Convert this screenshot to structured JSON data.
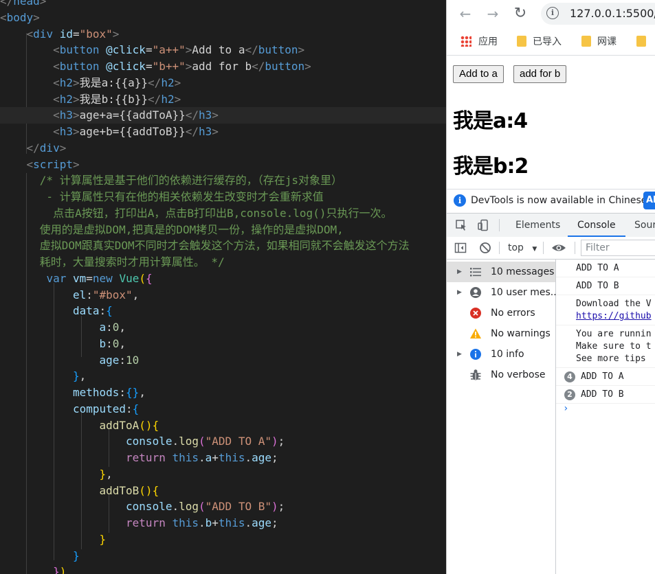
{
  "editor": {
    "lines": [
      [
        {
          "t": "</",
          "c": "t-tag"
        },
        {
          "t": "head",
          "c": "t-el"
        },
        {
          "t": ">",
          "c": "t-tag"
        }
      ],
      [
        {
          "t": "<",
          "c": "t-tag"
        },
        {
          "t": "body",
          "c": "t-el"
        },
        {
          "t": ">",
          "c": "t-tag"
        }
      ],
      [
        {
          "t": "    "
        },
        {
          "t": "<",
          "c": "t-tag"
        },
        {
          "t": "div",
          "c": "t-el"
        },
        {
          "t": " "
        },
        {
          "t": "id",
          "c": "t-attr"
        },
        {
          "t": "=",
          "c": "t-txt"
        },
        {
          "t": "\"box\"",
          "c": "t-str"
        },
        {
          "t": ">",
          "c": "t-tag"
        }
      ],
      [
        {
          "t": "        "
        },
        {
          "t": "<",
          "c": "t-tag"
        },
        {
          "t": "button",
          "c": "t-el"
        },
        {
          "t": " "
        },
        {
          "t": "@click",
          "c": "t-attr"
        },
        {
          "t": "=",
          "c": "t-txt"
        },
        {
          "t": "\"a++\"",
          "c": "t-str"
        },
        {
          "t": ">",
          "c": "t-tag"
        },
        {
          "t": "Add to a",
          "c": "t-txt"
        },
        {
          "t": "</",
          "c": "t-tag"
        },
        {
          "t": "button",
          "c": "t-el"
        },
        {
          "t": ">",
          "c": "t-tag"
        }
      ],
      [
        {
          "t": "        "
        },
        {
          "t": "<",
          "c": "t-tag"
        },
        {
          "t": "button",
          "c": "t-el"
        },
        {
          "t": " "
        },
        {
          "t": "@click",
          "c": "t-attr"
        },
        {
          "t": "=",
          "c": "t-txt"
        },
        {
          "t": "\"b++\"",
          "c": "t-str"
        },
        {
          "t": ">",
          "c": "t-tag"
        },
        {
          "t": "add for b",
          "c": "t-txt"
        },
        {
          "t": "</",
          "c": "t-tag"
        },
        {
          "t": "button",
          "c": "t-el"
        },
        {
          "t": ">",
          "c": "t-tag"
        }
      ],
      [
        {
          "t": "        "
        },
        {
          "t": "<",
          "c": "t-tag"
        },
        {
          "t": "h2",
          "c": "t-el"
        },
        {
          "t": ">",
          "c": "t-tag"
        },
        {
          "t": "我是a:{{a}}",
          "c": "t-txt"
        },
        {
          "t": "</",
          "c": "t-tag"
        },
        {
          "t": "h2",
          "c": "t-el"
        },
        {
          "t": ">",
          "c": "t-tag"
        }
      ],
      [
        {
          "t": "        "
        },
        {
          "t": "<",
          "c": "t-tag"
        },
        {
          "t": "h2",
          "c": "t-el"
        },
        {
          "t": ">",
          "c": "t-tag"
        },
        {
          "t": "我是b:{{b}}",
          "c": "t-txt"
        },
        {
          "t": "</",
          "c": "t-tag"
        },
        {
          "t": "h2",
          "c": "t-el"
        },
        {
          "t": ">",
          "c": "t-tag"
        }
      ],
      [
        {
          "t": "        "
        },
        {
          "t": "<",
          "c": "t-tag"
        },
        {
          "t": "h3",
          "c": "t-el"
        },
        {
          "t": ">",
          "c": "t-tag"
        },
        {
          "t": "age+a={{addToA}}",
          "c": "t-txt"
        },
        {
          "t": "</",
          "c": "t-tag"
        },
        {
          "t": "h3",
          "c": "t-el"
        },
        {
          "t": ">",
          "c": "t-tag"
        }
      ],
      [
        {
          "t": "        "
        },
        {
          "t": "<",
          "c": "t-tag"
        },
        {
          "t": "h3",
          "c": "t-el"
        },
        {
          "t": ">",
          "c": "t-tag"
        },
        {
          "t": "age+b={{addToB}}",
          "c": "t-txt"
        },
        {
          "t": "</",
          "c": "t-tag"
        },
        {
          "t": "h3",
          "c": "t-el"
        },
        {
          "t": ">",
          "c": "t-tag"
        }
      ],
      [
        {
          "t": "    "
        },
        {
          "t": "</",
          "c": "t-tag"
        },
        {
          "t": "div",
          "c": "t-el"
        },
        {
          "t": ">",
          "c": "t-tag"
        }
      ],
      [
        {
          "t": "    "
        },
        {
          "t": "<",
          "c": "t-tag"
        },
        {
          "t": "script",
          "c": "t-el"
        },
        {
          "t": ">",
          "c": "t-tag"
        }
      ],
      [
        {
          "t": "      "
        },
        {
          "t": "/* 计算属性是基于他们的依赖进行缓存的，（存在js对象里）",
          "c": "t-com"
        }
      ],
      [
        {
          "t": "      "
        },
        {
          "t": " - 计算属性只有在他的相关依赖发生改变时才会重新求值",
          "c": "t-com"
        }
      ],
      [
        {
          "t": "      "
        },
        {
          "t": "  点击A按钮，打印出A，点击B打印出B,console.log()只执行一次。",
          "c": "t-com"
        }
      ],
      [
        {
          "t": "      "
        },
        {
          "t": "使用的是虚拟DOM,把真是的DOM拷贝一份，操作的是虚拟DOM,",
          "c": "t-com"
        }
      ],
      [
        {
          "t": "      "
        },
        {
          "t": "虚拟DOM跟真实DOM不同时才会触发这个方法，如果相同就不会触发这个方法",
          "c": "t-com"
        }
      ],
      [
        {
          "t": "      "
        },
        {
          "t": "耗时，大量搜索时才用计算属性。 */",
          "c": "t-com"
        }
      ],
      [
        {
          "t": "       "
        },
        {
          "t": "var",
          "c": "t-kw"
        },
        {
          "t": " "
        },
        {
          "t": "vm",
          "c": "t-var"
        },
        {
          "t": "="
        },
        {
          "t": "new",
          "c": "t-kw"
        },
        {
          "t": " "
        },
        {
          "t": "Vue",
          "c": "t-cls"
        },
        {
          "t": "(",
          "c": "t-br1"
        },
        {
          "t": "{",
          "c": "t-br2"
        }
      ],
      [
        {
          "t": "           "
        },
        {
          "t": "el",
          "c": "t-var"
        },
        {
          "t": ":"
        },
        {
          "t": "\"#box\"",
          "c": "t-str"
        },
        {
          "t": ","
        }
      ],
      [
        {
          "t": "           "
        },
        {
          "t": "data",
          "c": "t-var"
        },
        {
          "t": ":"
        },
        {
          "t": "{",
          "c": "t-br3"
        }
      ],
      [
        {
          "t": "               "
        },
        {
          "t": "a",
          "c": "t-var"
        },
        {
          "t": ":"
        },
        {
          "t": "0",
          "c": "t-num"
        },
        {
          "t": ","
        }
      ],
      [
        {
          "t": "               "
        },
        {
          "t": "b",
          "c": "t-var"
        },
        {
          "t": ":"
        },
        {
          "t": "0",
          "c": "t-num"
        },
        {
          "t": ","
        }
      ],
      [
        {
          "t": "               "
        },
        {
          "t": "age",
          "c": "t-var"
        },
        {
          "t": ":"
        },
        {
          "t": "10",
          "c": "t-num"
        }
      ],
      [
        {
          "t": "           "
        },
        {
          "t": "}",
          "c": "t-br3"
        },
        {
          "t": ","
        }
      ],
      [
        {
          "t": "           "
        },
        {
          "t": "methods",
          "c": "t-var"
        },
        {
          "t": ":"
        },
        {
          "t": "{}",
          "c": "t-br3"
        },
        {
          "t": ","
        }
      ],
      [
        {
          "t": "           "
        },
        {
          "t": "computed",
          "c": "t-var"
        },
        {
          "t": ":"
        },
        {
          "t": "{",
          "c": "t-br3"
        }
      ],
      [
        {
          "t": "               "
        },
        {
          "t": "addToA",
          "c": "t-fn"
        },
        {
          "t": "()",
          "c": "t-br1"
        },
        {
          "t": "{",
          "c": "t-br1"
        }
      ],
      [
        {
          "t": "                   "
        },
        {
          "t": "console",
          "c": "t-var"
        },
        {
          "t": "."
        },
        {
          "t": "log",
          "c": "t-fn"
        },
        {
          "t": "(",
          "c": "t-br2"
        },
        {
          "t": "\"ADD TO A\"",
          "c": "t-str"
        },
        {
          "t": ")",
          "c": "t-br2"
        },
        {
          "t": ";"
        }
      ],
      [
        {
          "t": "                   "
        },
        {
          "t": "return",
          "c": "t-ctl"
        },
        {
          "t": " "
        },
        {
          "t": "this",
          "c": "t-kw"
        },
        {
          "t": "."
        },
        {
          "t": "a",
          "c": "t-var"
        },
        {
          "t": "+"
        },
        {
          "t": "this",
          "c": "t-kw"
        },
        {
          "t": "."
        },
        {
          "t": "age",
          "c": "t-var"
        },
        {
          "t": ";"
        }
      ],
      [
        {
          "t": "               "
        },
        {
          "t": "}",
          "c": "t-br1"
        },
        {
          "t": ","
        }
      ],
      [
        {
          "t": "               "
        },
        {
          "t": "addToB",
          "c": "t-fn"
        },
        {
          "t": "()",
          "c": "t-br1"
        },
        {
          "t": "{",
          "c": "t-br1"
        }
      ],
      [
        {
          "t": "                   "
        },
        {
          "t": "console",
          "c": "t-var"
        },
        {
          "t": "."
        },
        {
          "t": "log",
          "c": "t-fn"
        },
        {
          "t": "(",
          "c": "t-br2"
        },
        {
          "t": "\"ADD TO B\"",
          "c": "t-str"
        },
        {
          "t": ")",
          "c": "t-br2"
        },
        {
          "t": ";"
        }
      ],
      [
        {
          "t": "                   "
        },
        {
          "t": "return",
          "c": "t-ctl"
        },
        {
          "t": " "
        },
        {
          "t": "this",
          "c": "t-kw"
        },
        {
          "t": "."
        },
        {
          "t": "b",
          "c": "t-var"
        },
        {
          "t": "+"
        },
        {
          "t": "this",
          "c": "t-kw"
        },
        {
          "t": "."
        },
        {
          "t": "age",
          "c": "t-var"
        },
        {
          "t": ";"
        }
      ],
      [
        {
          "t": "               "
        },
        {
          "t": "}",
          "c": "t-br1"
        }
      ],
      [
        {
          "t": "           "
        },
        {
          "t": "}",
          "c": "t-br3"
        }
      ],
      [
        {
          "t": "        "
        },
        {
          "t": "}",
          "c": "t-br2"
        },
        {
          "t": ")",
          "c": "t-br1"
        }
      ]
    ],
    "active_line": 7
  },
  "browser": {
    "url": "127.0.0.1:5500/",
    "back_icon": "back-arrow-icon",
    "forward_icon": "forward-arrow-icon",
    "reload_icon": "reload-icon",
    "bookmarks": [
      "应用",
      "已导入",
      "网课",
      ""
    ],
    "page": {
      "button_a": "Add to a",
      "button_b": "add for b",
      "heading_a": "我是a:4",
      "heading_b": "我是b:2"
    }
  },
  "devtools": {
    "banner": "DevTools is now available in Chinese!",
    "banner_button": "Al",
    "tabs": [
      "Elements",
      "Console",
      "Sour"
    ],
    "selected_tab": "Console",
    "context": "top",
    "filter_placeholder": "Filter",
    "sidebar": [
      {
        "label": "10 messages",
        "icon": "list-icon",
        "expandable": true
      },
      {
        "label": "10 user mes...",
        "icon": "user-icon",
        "expandable": true
      },
      {
        "label": "No errors",
        "icon": "error-icon",
        "expandable": false
      },
      {
        "label": "No warnings",
        "icon": "warning-icon",
        "expandable": false
      },
      {
        "label": "10 info",
        "icon": "info-icon",
        "expandable": true
      },
      {
        "label": "No verbose",
        "icon": "bug-icon",
        "expandable": false
      }
    ],
    "console": {
      "msg1": "ADD TO A",
      "msg2": "ADD TO B",
      "download_line1": "Download the V",
      "download_line2": "https://github",
      "running_line1": "You are runnin",
      "running_line2": "Make sure to t",
      "running_line3": "See more tips",
      "grouped1_count": "4",
      "grouped1_text": "ADD TO A",
      "grouped2_count": "2",
      "grouped2_text": "ADD TO B",
      "prompt": "›"
    }
  },
  "colors": {
    "editor_bg": "#1e1e1e",
    "accent": "#1a73e8",
    "error": "#d93025",
    "warning": "#f9ab00"
  }
}
